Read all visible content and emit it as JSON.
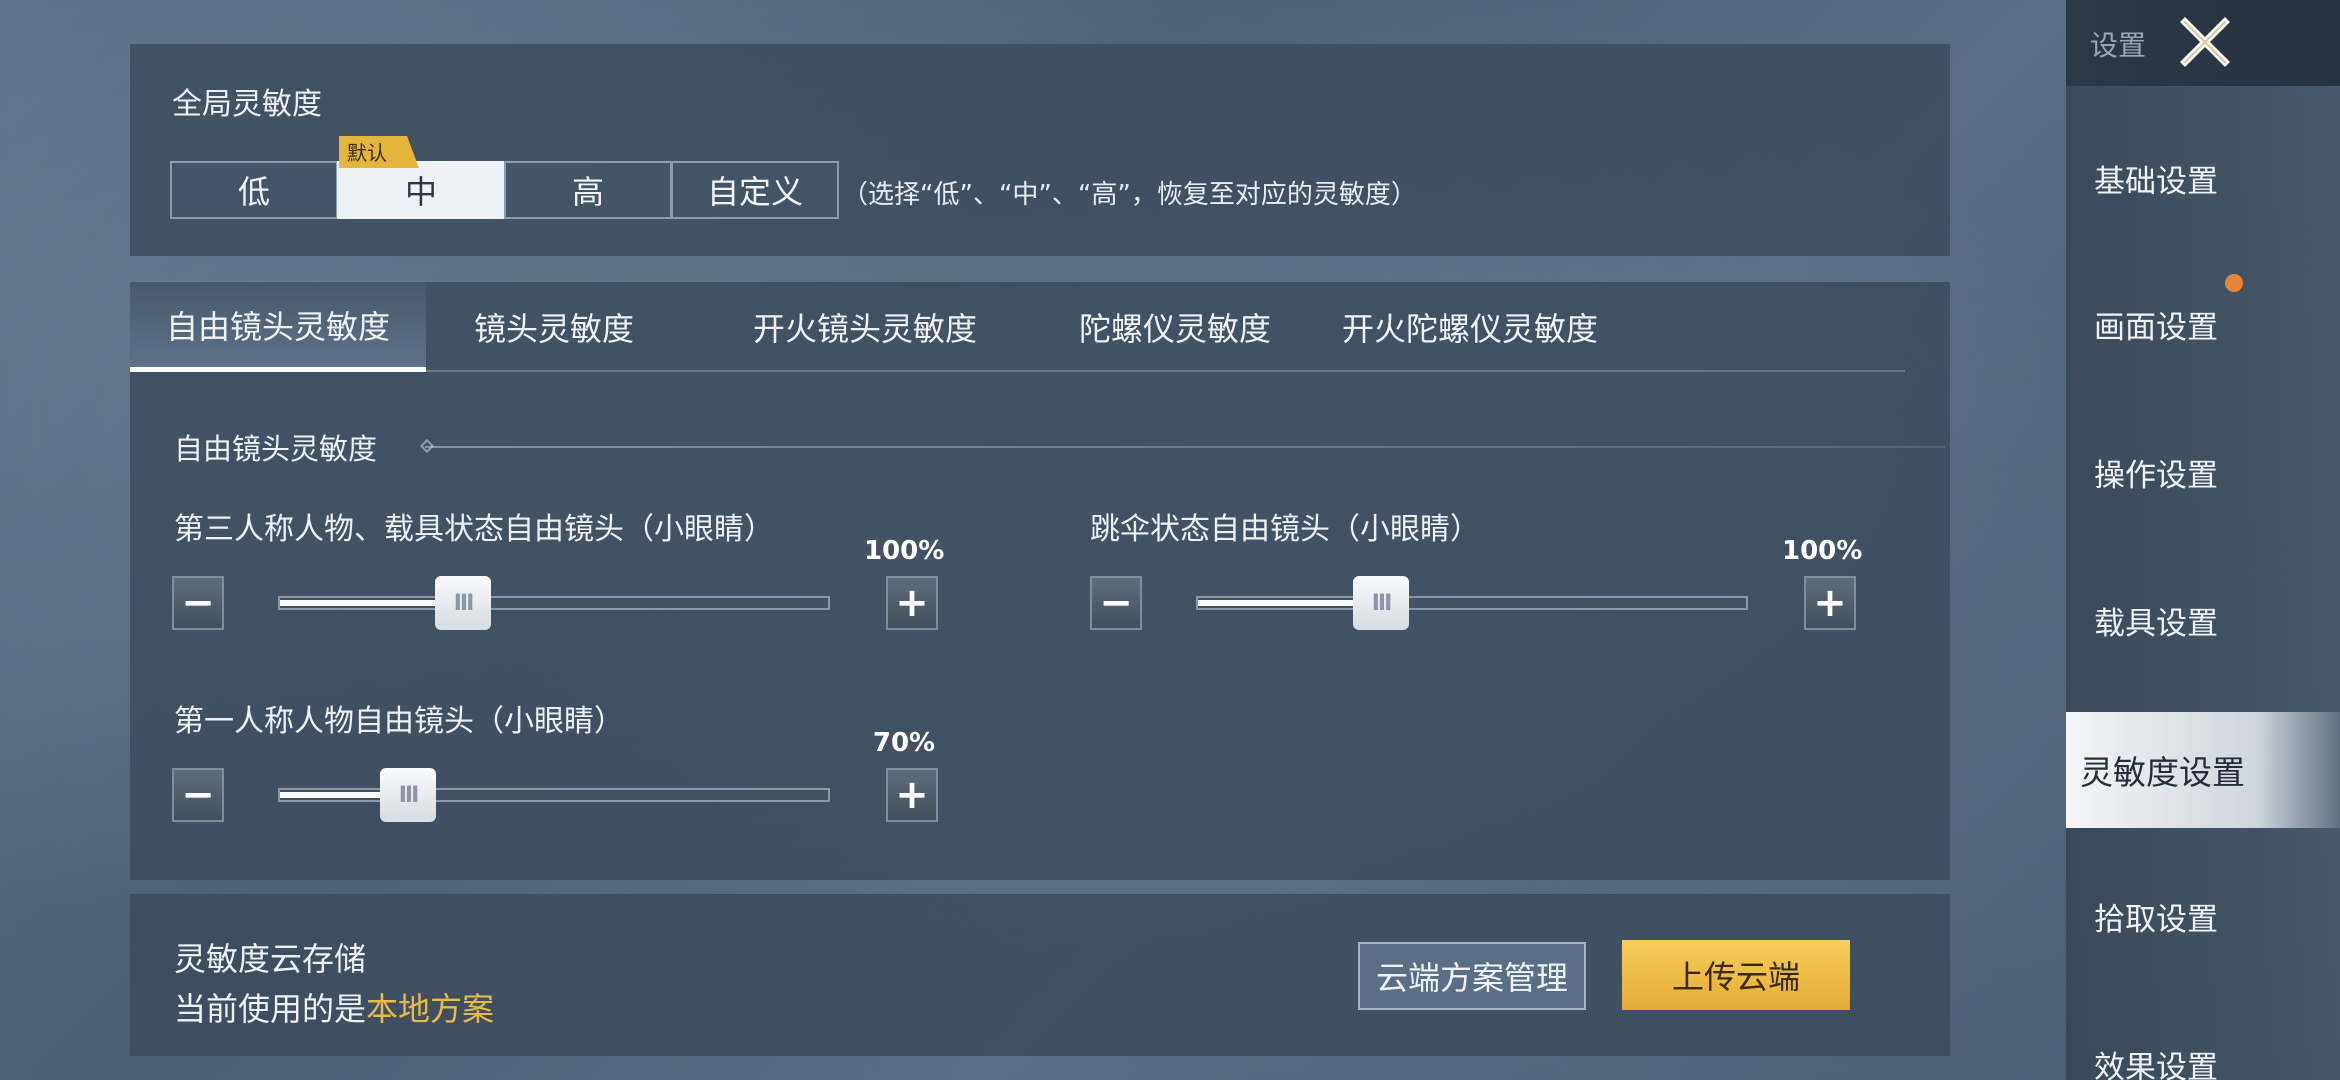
{
  "global": {
    "title": "全局灵敏度",
    "default_badge": "默认",
    "presets": [
      "低",
      "中",
      "高",
      "自定义"
    ],
    "active_preset": "中",
    "hint": "（选择“低”、“中”、“高”，恢复至对应的灵敏度）"
  },
  "tabs": [
    "自由镜头灵敏度",
    "镜头灵敏度",
    "开火镜头灵敏度",
    "陀螺仪灵敏度",
    "开火陀螺仪灵敏度"
  ],
  "active_tab": "自由镜头灵敏度",
  "section": {
    "title": "自由镜头灵敏度",
    "sliders": [
      {
        "label": "第三人称人物、载具状态自由镜头（小眼睛）",
        "value_text": "100%",
        "value": 100
      },
      {
        "label": "跳伞状态自由镜头（小眼睛）",
        "value_text": "100%",
        "value": 100
      },
      {
        "label": "第一人称人物自由镜头（小眼睛）",
        "value_text": "70%",
        "value": 70
      }
    ],
    "minus_symbol": "−",
    "plus_symbol": "+",
    "thumb_grip": "III"
  },
  "cloud": {
    "title": "灵敏度云存储",
    "status_prefix": "当前使用的是",
    "status_value": "本地方案",
    "manage_label": "云端方案管理",
    "upload_label": "上传云端"
  },
  "sidebar": {
    "header": "设置",
    "close_icon": "close-x-icon",
    "items": [
      "基础设置",
      "画面设置",
      "操作设置",
      "载具设置",
      "灵敏度设置",
      "拾取设置",
      "效果设置"
    ],
    "active_item": "灵敏度设置"
  },
  "colors": {
    "accent_gold": "#e3b53c",
    "highlight_text": "#e9b94a",
    "notify_dot": "#e8843a"
  }
}
